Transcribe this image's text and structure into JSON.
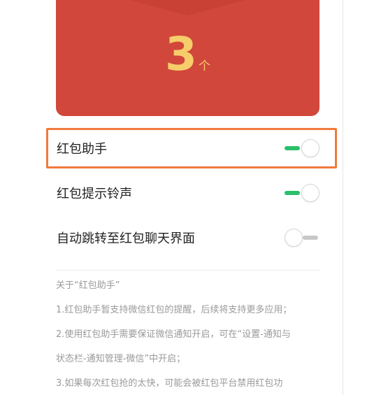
{
  "envelope": {
    "count": "3",
    "unit": "个"
  },
  "settings": [
    {
      "label": "红包助手",
      "enabled": true
    },
    {
      "label": "红包提示铃声",
      "enabled": true
    },
    {
      "label": "自动跳转至红包聊天界面",
      "enabled": false
    }
  ],
  "about": {
    "title": "关于“红包助手”",
    "lines": [
      "1.红包助手暂支持微信红包的提醒，后续将支持更多应用；",
      "2.使用红包助手需要保证微信通知开启，可在“设置-通知与",
      "状态栏-通知管理-微信”中开启；",
      "3.如果每次红包抢的太快，可能会被红包平台禁用红包功"
    ]
  },
  "colors": {
    "envelope_red": "#d2473b",
    "envelope_flap": "#c94035",
    "count_gold": "#f6cd6a",
    "toggle_on": "#2bbf6a",
    "toggle_off": "#c8c8c8",
    "highlight": "#f07a3c"
  }
}
